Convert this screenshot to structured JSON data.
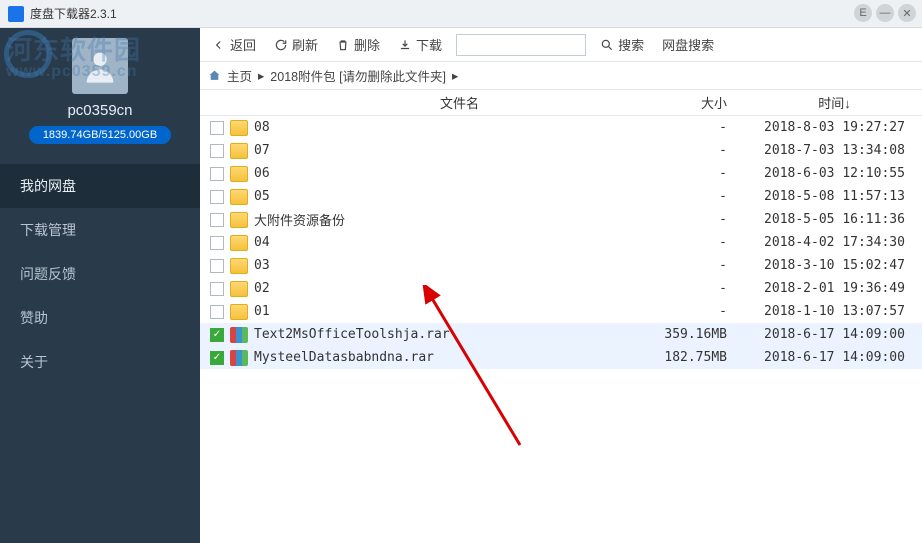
{
  "titlebar": {
    "title": "度盘下载器2.3.1"
  },
  "watermark": {
    "text": "河东软件园",
    "url": "www.pc0359.cn"
  },
  "sidebar": {
    "username": "pc0359cn",
    "storage": "1839.74GB/5125.00GB",
    "nav": [
      {
        "label": "我的网盘",
        "active": true
      },
      {
        "label": "下载管理",
        "active": false
      },
      {
        "label": "问题反馈",
        "active": false
      },
      {
        "label": "赞助",
        "active": false
      },
      {
        "label": "关于",
        "active": false
      }
    ]
  },
  "toolbar": {
    "back": "返回",
    "refresh": "刷新",
    "delete": "删除",
    "download": "下载",
    "search": "搜索",
    "netdisk_search": "网盘搜索",
    "search_placeholder": ""
  },
  "breadcrumb": {
    "home": "主页",
    "path": "2018附件包 [请勿删除此文件夹]"
  },
  "table": {
    "headers": {
      "name": "文件名",
      "size": "大小",
      "time": "时间↓"
    },
    "rows": [
      {
        "name": "08",
        "type": "folder",
        "size": "-",
        "time": "2018-8-03 19:27:27",
        "selected": false
      },
      {
        "name": "07",
        "type": "folder",
        "size": "-",
        "time": "2018-7-03 13:34:08",
        "selected": false
      },
      {
        "name": "06",
        "type": "folder",
        "size": "-",
        "time": "2018-6-03 12:10:55",
        "selected": false
      },
      {
        "name": "05",
        "type": "folder",
        "size": "-",
        "time": "2018-5-08 11:57:13",
        "selected": false
      },
      {
        "name": "大附件资源备份",
        "type": "folder",
        "size": "-",
        "time": "2018-5-05 16:11:36",
        "selected": false
      },
      {
        "name": "04",
        "type": "folder",
        "size": "-",
        "time": "2018-4-02 17:34:30",
        "selected": false
      },
      {
        "name": "03",
        "type": "folder",
        "size": "-",
        "time": "2018-3-10 15:02:47",
        "selected": false
      },
      {
        "name": "02",
        "type": "folder",
        "size": "-",
        "time": "2018-2-01 19:36:49",
        "selected": false
      },
      {
        "name": "01",
        "type": "folder",
        "size": "-",
        "time": "2018-1-10 13:07:57",
        "selected": false
      },
      {
        "name": "Text2MsOfficeToolshja.rar",
        "type": "rar",
        "size": "359.16MB",
        "time": "2018-6-17 14:09:00",
        "selected": true
      },
      {
        "name": "MysteelDatasbabndna.rar",
        "type": "rar",
        "size": "182.75MB",
        "time": "2018-6-17 14:09:00",
        "selected": true
      }
    ]
  }
}
